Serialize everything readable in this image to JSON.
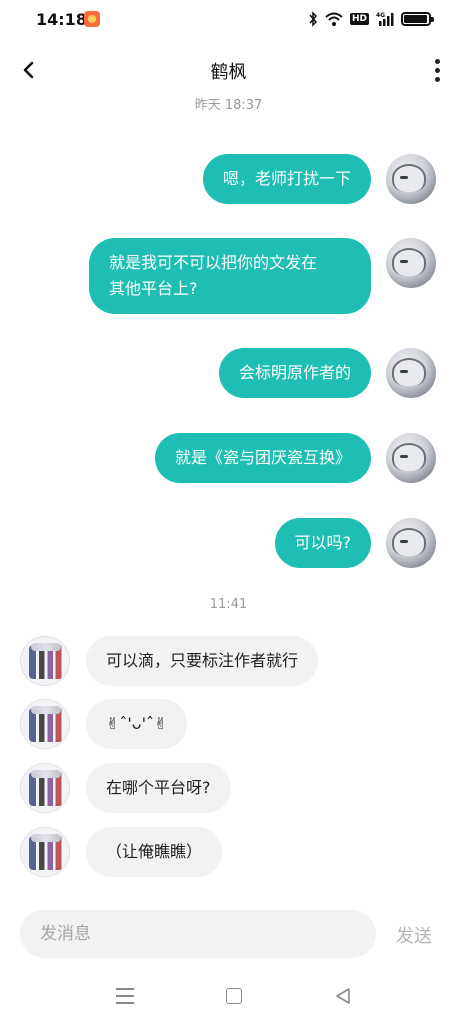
{
  "status_bar": {
    "time": "14:18",
    "hd_label": "HD",
    "network_label": "4G",
    "battery_level": 0.88
  },
  "header": {
    "title": "鹤枫"
  },
  "timestamps": {
    "first": "昨天 18:37",
    "second": "11:41"
  },
  "messages_sent": [
    {
      "lines": [
        "嗯，老师打扰一下"
      ]
    },
    {
      "lines": [
        "就是我可不可以把你的文发在",
        "其他平台上?"
      ]
    },
    {
      "lines": [
        "会标明原作者的"
      ]
    },
    {
      "lines": [
        "就是《瓷与团厌瓷互换》"
      ]
    },
    {
      "lines": [
        "可以吗?"
      ]
    }
  ],
  "messages_received": [
    {
      "text": "可以滴，只要标注作者就行"
    },
    {
      "text": "✌︎ˆ'ᴗ'ˆ✌︎"
    },
    {
      "text": "在哪个平台呀?"
    },
    {
      "text": "（让俺瞧瞧）"
    }
  ],
  "composer": {
    "placeholder": "发消息",
    "send_label": "发送"
  },
  "colors": {
    "sent_bubble": "#1fbeb4",
    "received_bubble": "#f2f2f2",
    "timestamp": "#9a9a9a"
  }
}
